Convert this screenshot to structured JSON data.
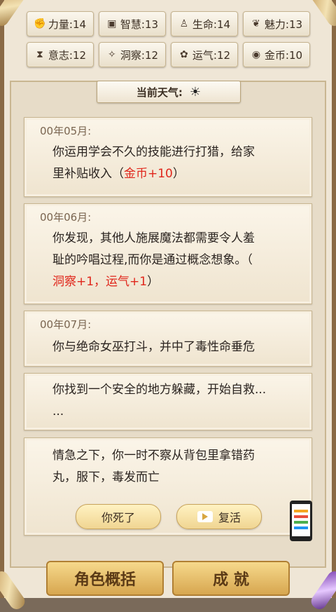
{
  "stats": [
    {
      "label": "力量:14",
      "icon": "strength-icon",
      "glyph": "✊"
    },
    {
      "label": "智慧:13",
      "icon": "book-icon",
      "glyph": "▣"
    },
    {
      "label": "生命:14",
      "icon": "person-icon",
      "glyph": "♙"
    },
    {
      "label": "魅力:13",
      "icon": "charm-icon",
      "glyph": "❦"
    },
    {
      "label": "意志:12",
      "icon": "hourglass-icon",
      "glyph": "⧗"
    },
    {
      "label": "洞察:12",
      "icon": "bird-icon",
      "glyph": "✧"
    },
    {
      "label": "运气:12",
      "icon": "flower-icon",
      "glyph": "✿"
    },
    {
      "label": "金币:10",
      "icon": "coin-icon",
      "glyph": "◉"
    }
  ],
  "weather": {
    "label": "当前天气:",
    "icon": "sun-icon",
    "glyph": "☀"
  },
  "events": [
    {
      "date": "00年05月:",
      "line1": "你运用学会不久的技能进行打猎，给家",
      "line2_pre": "里补贴收入（",
      "line2_red": "金币+10",
      "line2_post": "）"
    },
    {
      "date": "00年06月:",
      "line1": "你发现，其他人施展魔法都需要令人羞",
      "line2": "耻的吟唱过程,而你是通过概念想象。（",
      "line3_red": "洞察+1，运气+1",
      "line3_post": "）"
    },
    {
      "date": "00年07月:",
      "line1": "你与绝命女巫打斗，并中了毒性命垂危"
    },
    {
      "line1": "你找到一个安全的地方躲藏，开始自救...",
      "line2": "..."
    },
    {
      "line1": "情急之下，你一时不察从背包里拿错药",
      "line2": "丸，服下，毒发而亡"
    }
  ],
  "buttons": {
    "dead": "你死了",
    "revive": "复活"
  },
  "bottom": {
    "left": "角色概括",
    "right": "成 就"
  }
}
